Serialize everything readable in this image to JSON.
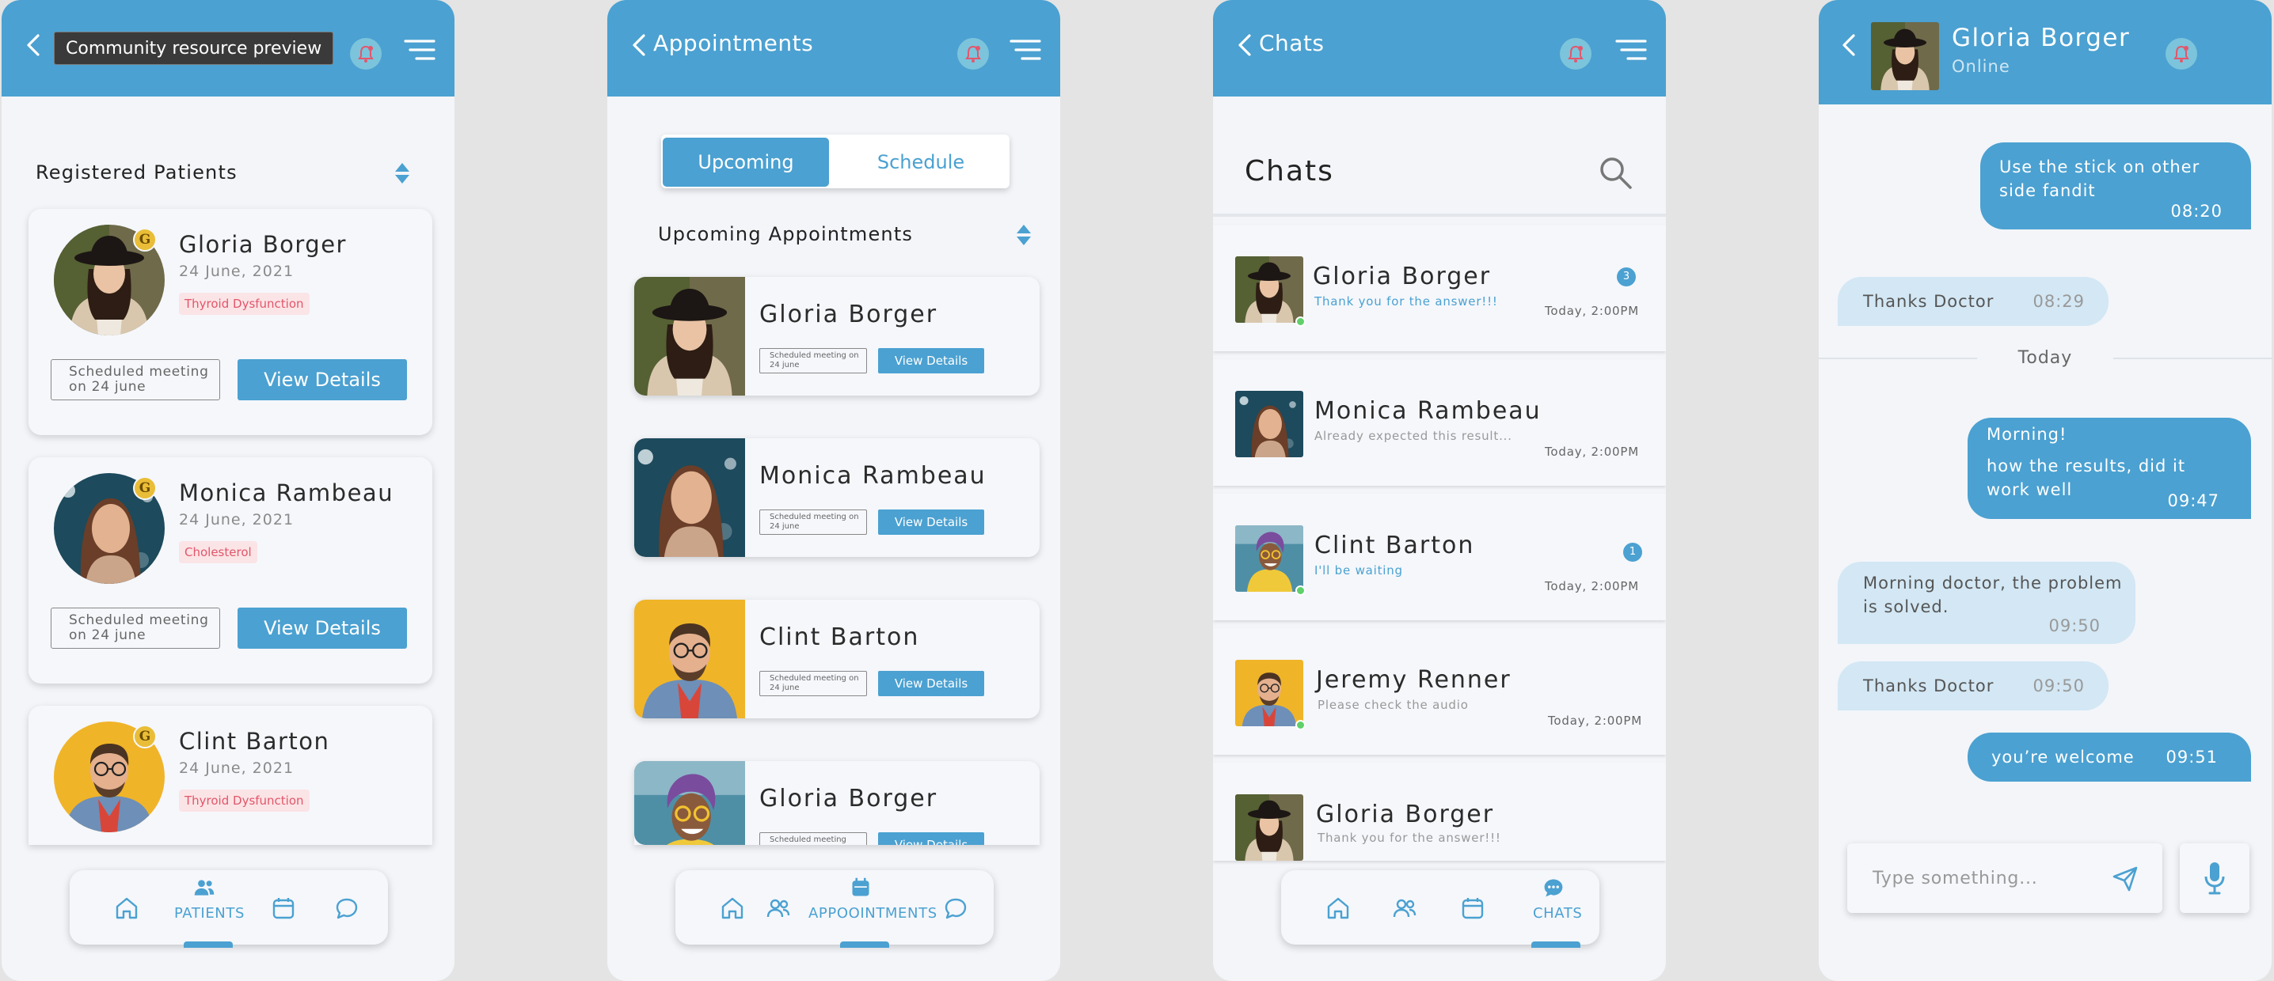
{
  "screens": {
    "patients": {
      "tooltip": "Community resource preview",
      "section_title": "Registered Patients",
      "patients": [
        {
          "name": "Gloria Borger",
          "date": "24 June, 2021",
          "tag": "Thyroid Dysfunction",
          "meeting": "Scheduled meeting on 24 june",
          "action": "View Details",
          "badge": "G"
        },
        {
          "name": "Monica Rambeau",
          "date": "24 June, 2021",
          "tag": "Cholesterol",
          "meeting": "Scheduled meeting on 24 june",
          "action": "View Details",
          "badge": "G"
        },
        {
          "name": "Clint Barton",
          "date": "24 June, 2021",
          "tag": "Thyroid Dysfunction",
          "badge": "G"
        }
      ],
      "nav_label": "PATIENTS"
    },
    "appointments": {
      "header_title": "Appointments",
      "tabs": [
        "Upcoming",
        "Schedule"
      ],
      "section_title": "Upcoming Appointments",
      "items": [
        {
          "name": "Gloria Borger",
          "meeting": "Scheduled meeting on 24 june",
          "action": "View Details"
        },
        {
          "name": "Monica Rambeau",
          "meeting": "Scheduled meeting on 24 june",
          "action": "View Details"
        },
        {
          "name": "Clint Barton",
          "meeting": "Scheduled meeting on 24 june",
          "action": "View Details"
        },
        {
          "name": "Gloria Borger",
          "meeting": "Scheduled meeting",
          "action": "View Details"
        }
      ],
      "nav_label": "APPOOINTMENTS"
    },
    "chats": {
      "header_title": "Chats",
      "title": "Chats",
      "items": [
        {
          "name": "Gloria Borger",
          "preview": "Thank you for the answer!!!",
          "time": "Today, 2:00PM",
          "unread": "3",
          "online": true
        },
        {
          "name": "Monica Rambeau",
          "preview": "Already expected this result...",
          "time": "Today, 2:00PM",
          "online": false
        },
        {
          "name": "Clint Barton",
          "preview": "I'll be waiting",
          "time": "Today, 2:00PM",
          "unread": "1",
          "online": true
        },
        {
          "name": "Jeremy Renner",
          "preview": "Please check the audio",
          "time": "Today, 2:00PM",
          "online": true
        },
        {
          "name": "Gloria Borger",
          "preview": "Thank you for the answer!!!",
          "online": false
        }
      ],
      "nav_label": "CHATS"
    },
    "chat_detail": {
      "contact_name": "Gloria Borger",
      "status": "Online",
      "messages": [
        {
          "dir": "out",
          "lines": [
            "Use the stick on  other",
            "side fandit"
          ],
          "time": "08:20"
        },
        {
          "dir": "in",
          "lines": [
            "Thanks Doctor"
          ],
          "time": "08:29"
        },
        {
          "dir": "out",
          "lines": [
            "Morning!",
            "how the results, did it",
            "work well"
          ],
          "time": "09:47"
        },
        {
          "dir": "in",
          "lines": [
            "Morning doctor, the problem",
            "is solved."
          ],
          "time": "09:50"
        },
        {
          "dir": "in",
          "lines": [
            "Thanks Doctor"
          ],
          "time": "09:50"
        },
        {
          "dir": "out",
          "lines": [
            "you’re welcome"
          ],
          "time": "09:51"
        }
      ],
      "day_divider": "Today",
      "input_placeholder": "Type something..."
    }
  },
  "colors": {
    "primary": "#4ba1d1",
    "background": "#f3f5f9",
    "tag_bg": "#fbe4e6",
    "tag_text": "#e2566a",
    "online": "#5fd06a"
  },
  "icons": [
    "chevron-left-icon",
    "bell-icon",
    "menu-icon",
    "sort-icon",
    "search-icon",
    "home-icon",
    "users-icon",
    "calendar-icon",
    "chat-icon",
    "send-icon",
    "mic-icon"
  ]
}
